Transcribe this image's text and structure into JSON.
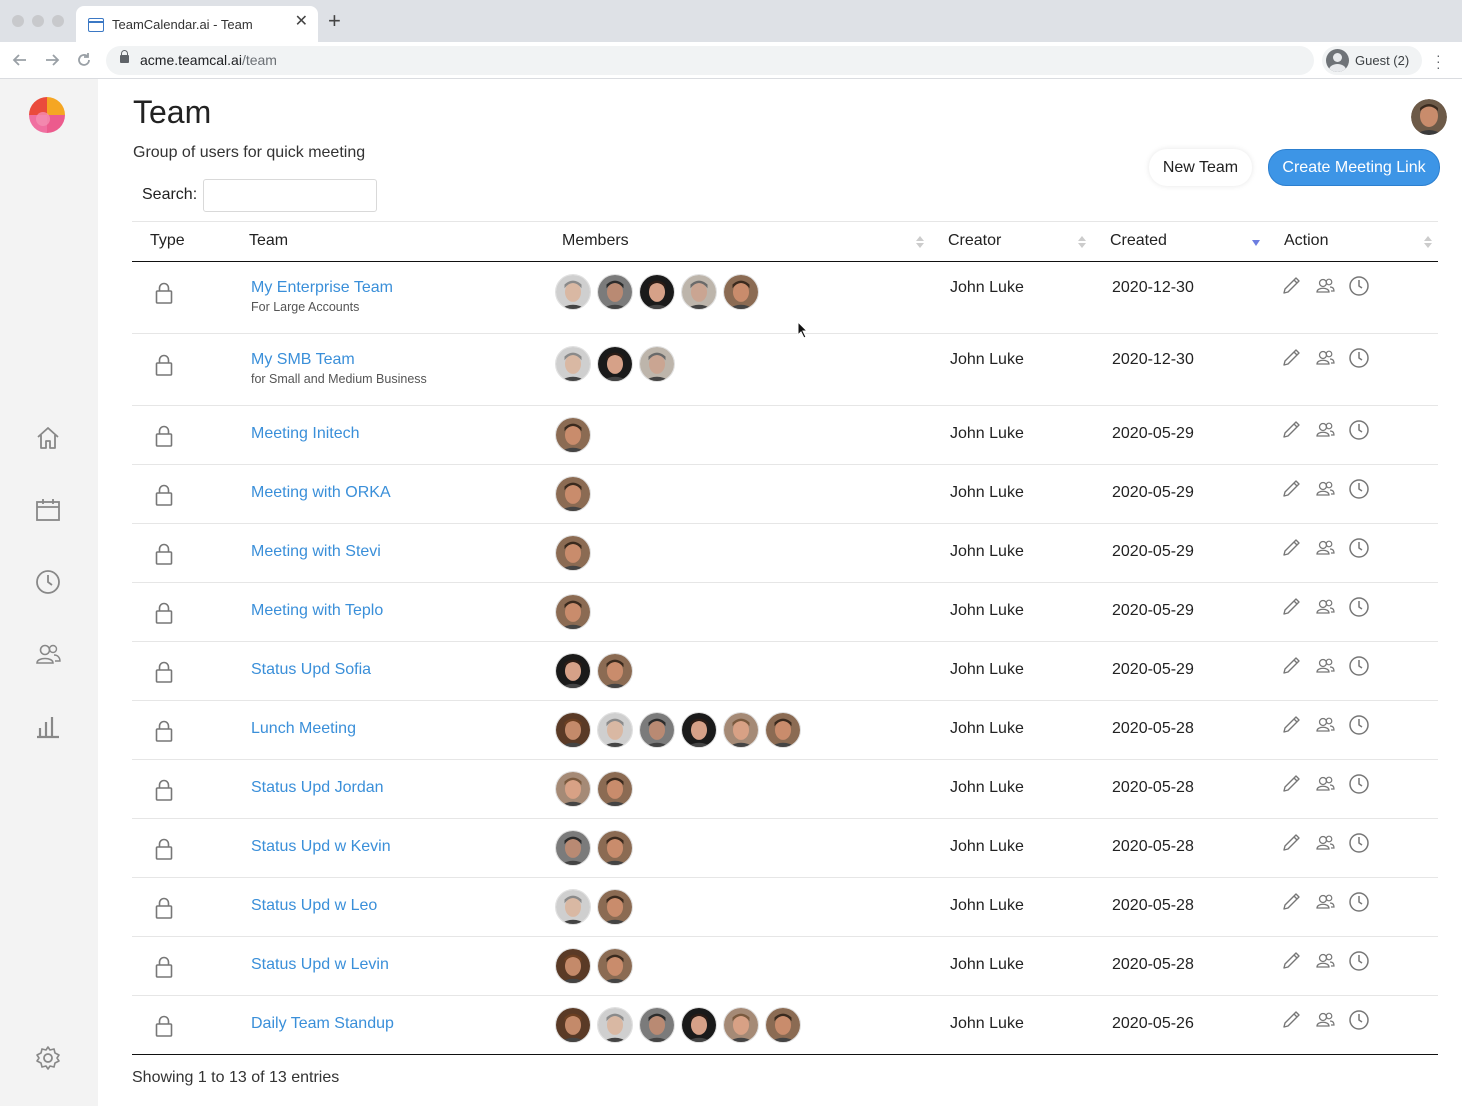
{
  "browser": {
    "tab_title": "TeamCalendar.ai - Team",
    "tab_close": "✕",
    "new_tab": "+",
    "url_host": "acme.teamcal.ai",
    "url_path": "/team",
    "profile_label": "Guest (2)",
    "back_icon": "arrow-left-icon",
    "forward_icon": "arrow-right-icon",
    "reload_icon": "reload-icon"
  },
  "sidebar": {
    "items": [
      "home-icon",
      "calendar-icon",
      "clock-icon",
      "team-icon",
      "bar-chart-icon"
    ],
    "settings": "gear-icon"
  },
  "page": {
    "title": "Team",
    "subtitle": "Group of users for quick meeting",
    "new_team_label": "New Team",
    "create_link_label": "Create Meeting Link",
    "search_label": "Search:",
    "search_value": ""
  },
  "table": {
    "headers": {
      "type": "Type",
      "team": "Team",
      "members": "Members",
      "creator": "Creator",
      "created": "Created",
      "action": "Action"
    },
    "sorted_column": "created",
    "sort_direction": "desc",
    "rows": [
      {
        "name": "My Enterprise Team",
        "desc": "For Large Accounts",
        "members": [
          "gray",
          "beard",
          "woman",
          "gray2",
          "brown"
        ],
        "creator": "John Luke",
        "created": "2020-12-30"
      },
      {
        "name": "My SMB Team",
        "desc": "for Small and Medium Business",
        "members": [
          "gray",
          "woman",
          "gray2"
        ],
        "creator": "John Luke",
        "created": "2020-12-30"
      },
      {
        "name": "Meeting Initech",
        "desc": "",
        "members": [
          "brown"
        ],
        "creator": "John Luke",
        "created": "2020-05-29"
      },
      {
        "name": "Meeting with ORKA",
        "desc": "",
        "members": [
          "brown"
        ],
        "creator": "John Luke",
        "created": "2020-05-29"
      },
      {
        "name": "Meeting with Stevi",
        "desc": "",
        "members": [
          "brown"
        ],
        "creator": "John Luke",
        "created": "2020-05-29"
      },
      {
        "name": "Meeting with Teplo",
        "desc": "",
        "members": [
          "brown"
        ],
        "creator": "John Luke",
        "created": "2020-05-29"
      },
      {
        "name": "Status Upd Sofia",
        "desc": "",
        "members": [
          "woman",
          "brown"
        ],
        "creator": "John Luke",
        "created": "2020-05-29"
      },
      {
        "name": "Lunch Meeting",
        "desc": "",
        "members": [
          "curly",
          "gray",
          "beard",
          "woman",
          "smile",
          "brown"
        ],
        "creator": "John Luke",
        "created": "2020-05-28"
      },
      {
        "name": "Status Upd Jordan",
        "desc": "",
        "members": [
          "smile",
          "brown"
        ],
        "creator": "John Luke",
        "created": "2020-05-28"
      },
      {
        "name": "Status Upd w Kevin",
        "desc": "",
        "members": [
          "beard",
          "brown"
        ],
        "creator": "John Luke",
        "created": "2020-05-28"
      },
      {
        "name": "Status Upd w Leo",
        "desc": "",
        "members": [
          "gray",
          "brown"
        ],
        "creator": "John Luke",
        "created": "2020-05-28"
      },
      {
        "name": "Status Upd w Levin",
        "desc": "",
        "members": [
          "curly",
          "brown"
        ],
        "creator": "John Luke",
        "created": "2020-05-28"
      },
      {
        "name": "Daily Team Standup",
        "desc": "",
        "members": [
          "curly",
          "gray",
          "beard",
          "woman",
          "smile",
          "brown"
        ],
        "creator": "John Luke",
        "created": "2020-05-26"
      }
    ],
    "actions": [
      "pencil-icon",
      "team-icon",
      "clock-icon"
    ]
  },
  "footer": {
    "info": "Showing 1 to 13 of 13 entries"
  },
  "colors": {
    "accent": "#3d95e6",
    "link": "#3a8fd9",
    "sidebar_bg": "#f3f3f3",
    "logo_orange": "#f5a623",
    "logo_pink": "#ec5b8d",
    "logo_red": "#ea4b3c"
  }
}
